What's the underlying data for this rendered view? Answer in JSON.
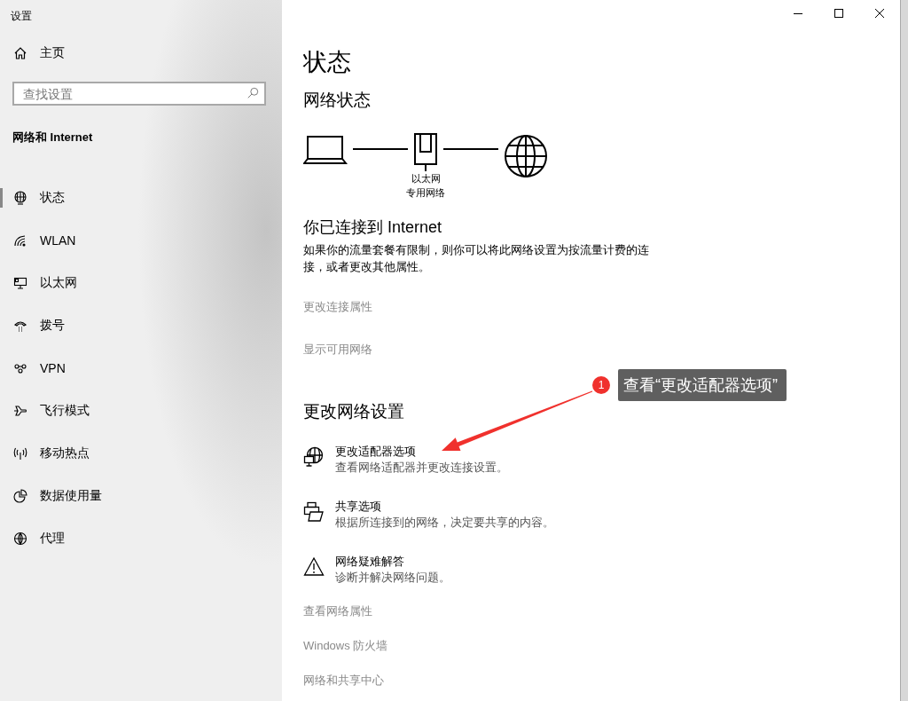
{
  "window": {
    "title": "设置"
  },
  "sidebar": {
    "home": "主页",
    "search": {
      "placeholder": "查找设置"
    },
    "section": "网络和 Internet",
    "items": [
      {
        "label": "状态",
        "selected": true
      },
      {
        "label": "WLAN",
        "selected": false
      },
      {
        "label": "以太网",
        "selected": false
      },
      {
        "label": "拨号",
        "selected": false
      },
      {
        "label": "VPN",
        "selected": false
      },
      {
        "label": "飞行模式",
        "selected": false
      },
      {
        "label": "移动热点",
        "selected": false
      },
      {
        "label": "数据使用量",
        "selected": false
      },
      {
        "label": "代理",
        "selected": false
      }
    ]
  },
  "main": {
    "title": "状态",
    "network_status": "网络状态",
    "diagram": {
      "adapter": "以太网",
      "profile": "专用网络"
    },
    "connected_title": "你已连接到 Internet",
    "connected_description": "如果你的流量套餐有限制，则你可以将此网络设置为按流量计费的连接，或者更改其他属性。",
    "links": [
      "更改连接属性",
      "显示可用网络"
    ],
    "change_title": "更改网络设置",
    "options": [
      {
        "title": "更改适配器选项",
        "description": "查看网络适配器并更改连接设置。"
      },
      {
        "title": "共享选项",
        "description": "根据所连接到的网络，决定要共享的内容。"
      },
      {
        "title": "网络疑难解答",
        "description": "诊断并解决网络问题。"
      }
    ],
    "bottom_links": [
      "查看网络属性",
      "Windows 防火墙",
      "网络和共享中心"
    ]
  },
  "annotation": {
    "number": "1",
    "text": "查看“更改适配器选项”"
  }
}
